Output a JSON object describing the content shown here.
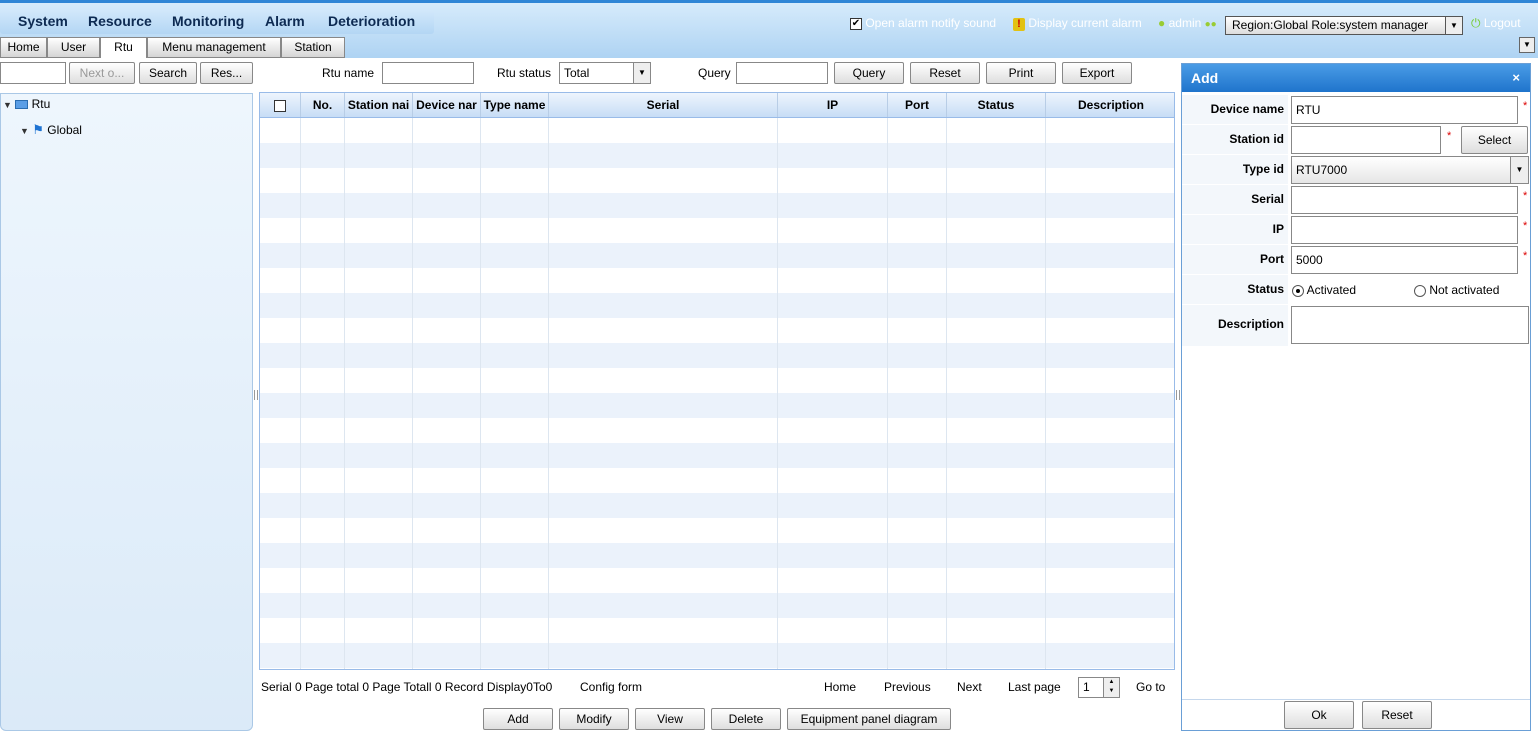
{
  "menu": {
    "system": "System",
    "resource": "Resource",
    "monitoring": "Monitoring",
    "alarm": "Alarm",
    "deterioration": "Deterioration"
  },
  "header": {
    "alarm_sound_label": "Open alarm notify sound",
    "alarm_sound_checked": true,
    "display_alarm_label": "Display current alarm",
    "user": "admin",
    "region_role": "Region:Global Role:system manager",
    "logout": "Logout"
  },
  "tabs": [
    {
      "label": "Home"
    },
    {
      "label": "User"
    },
    {
      "label": "Rtu",
      "active": true
    },
    {
      "label": "Menu management"
    },
    {
      "label": "Station"
    }
  ],
  "tree_search": {
    "next_label": "Next o...",
    "search_label": "Search",
    "reset_label": "Res..."
  },
  "tree": {
    "root": "Rtu",
    "child": "Global"
  },
  "filters": {
    "rtu_name_label": "Rtu name",
    "rtu_status_label": "Rtu status",
    "rtu_status_value": "Total",
    "query_label": "Query",
    "query_btn": "Query",
    "reset_btn": "Reset",
    "print_btn": "Print",
    "export_btn": "Export"
  },
  "table": {
    "columns": [
      "No.",
      "Station nai",
      "Device nar",
      "Type name",
      "Serial",
      "IP",
      "Port",
      "Status",
      "Description"
    ],
    "rows": []
  },
  "pager": {
    "summary": "Serial 0 Page total 0 Page Totall 0 Record Display0To0",
    "config": "Config form",
    "home": "Home",
    "previous": "Previous",
    "next": "Next",
    "last": "Last page",
    "page": "1",
    "goto": "Go to"
  },
  "actions": {
    "add": "Add",
    "modify": "Modify",
    "view": "View",
    "delete": "Delete",
    "panel_diagram": "Equipment panel diagram"
  },
  "form": {
    "title": "Add",
    "close": "×",
    "device_name_label": "Device name",
    "device_name": "RTU",
    "station_id_label": "Station id",
    "station_id": "",
    "select_btn": "Select",
    "type_id_label": "Type id",
    "type_id": "RTU7000",
    "serial_label": "Serial",
    "serial": "",
    "ip_label": "IP",
    "ip": "",
    "port_label": "Port",
    "port": "5000",
    "status_label": "Status",
    "status_activated": "Activated",
    "status_not_activated": "Not activated",
    "status_value": "Activated",
    "description_label": "Description",
    "description": "",
    "required_mark": "*",
    "ok_btn": "Ok",
    "reset_btn": "Reset"
  },
  "colors": {
    "header_border": "#2f86d6",
    "panel_head": "#1f74cc",
    "required": "#dd0000"
  }
}
